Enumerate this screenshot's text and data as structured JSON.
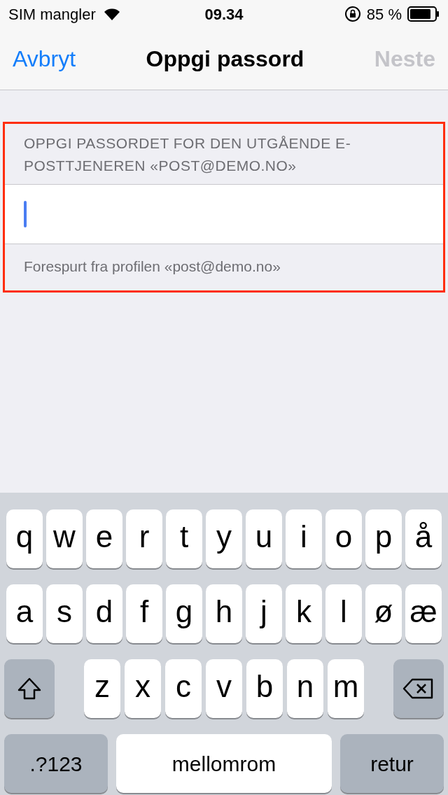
{
  "status_bar": {
    "carrier": "SIM mangler",
    "time": "09.34",
    "battery": "85 %"
  },
  "nav_bar": {
    "cancel": "Avbryt",
    "title": "Oppgi passord",
    "next": {
      "label": "Neste",
      "disabled": true
    }
  },
  "form": {
    "highlighted": true,
    "header": "OPPGI PASSORDET FOR DEN UTGÅENDE E-POSTTJENEREN «POST@DEMO.NO»",
    "password_field": {
      "focused": true
    },
    "footer": "Forespurt fra profilen «post@demo.no»"
  },
  "keyboard": {
    "letter_rows": [
      [
        "q",
        "w",
        "e",
        "r",
        "t",
        "y",
        "u",
        "i",
        "o",
        "p",
        "å"
      ],
      [
        "a",
        "s",
        "d",
        "f",
        "g",
        "h",
        "j",
        "k",
        "l",
        "ø",
        "æ"
      ],
      [
        "z",
        "x",
        "c",
        "v",
        "b",
        "n",
        "m"
      ]
    ],
    "side_keys": [
      {
        "kind": "shift"
      },
      {
        "kind": "delete"
      }
    ],
    "bottom_row": [
      {
        "kind": "numbers",
        "label": ".?123"
      },
      {
        "kind": "space",
        "label": "mellomrom"
      },
      {
        "kind": "return",
        "label": "retur"
      }
    ]
  }
}
